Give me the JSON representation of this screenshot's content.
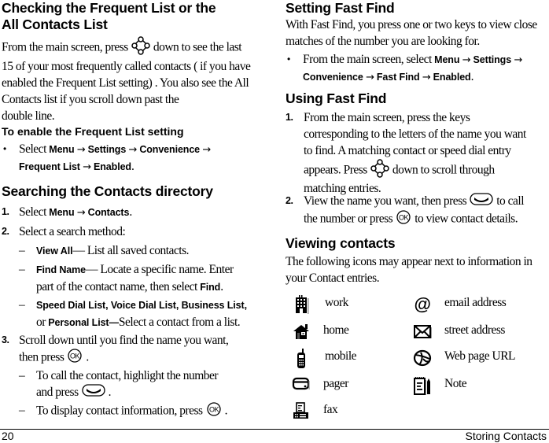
{
  "left": {
    "freq_heading_line1": "Checking the Frequent List or the",
    "freq_heading_line2": "All Contacts List",
    "freq_para": {
      "l1_a": "From the main screen, press",
      "l1_b": "down to see the last",
      "l2": "15 of your most frequently called contacts ( if you have",
      "l3": "enabled the Frequent List setting) . You also see the All",
      "l4": "Contacts list if you scroll down past the",
      "l5": "double line."
    },
    "enable_heading": "To enable the Frequent List setting",
    "enable_bullet": {
      "marker": "•",
      "select": "Select",
      "menu": "Menu",
      "settings": "Settings",
      "convenience": "Convenience",
      "frequent_list": "Frequent List",
      "enabled": "Enabled",
      "arrow": "→",
      "period": "."
    },
    "search_heading": "Searching the Contacts directory",
    "steps": [
      {
        "num": "1.",
        "select": "Select",
        "menu": "Menu",
        "contacts": "Contacts",
        "arrow": "→",
        "period": "."
      },
      {
        "num": "2.",
        "text": "Select a search method:"
      },
      {
        "num": "3.",
        "l1": "Scroll down until you find the name you want,",
        "l2": "then press",
        "period": "."
      }
    ],
    "search_methods": [
      {
        "dash": "–",
        "name": "View All",
        "sep": "—",
        "desc": " List all saved contacts."
      },
      {
        "dash": "–",
        "name": "Find Name",
        "sep": "—",
        "desc": " Locate a specific name. Enter",
        "l2": "part of the contact name, then select ",
        "find": "Find",
        "period": "."
      },
      {
        "dash": "–",
        "name": "Speed Dial List, Voice Dial List, Business List,",
        "l2_or": "or ",
        "personal": "Personal List",
        "sep": "—",
        "desc": "Select a contact from a list."
      }
    ],
    "step3_subs": [
      {
        "dash": "–",
        "l1": "To call the contact, highlight the number",
        "l2": "and press",
        "period": "."
      },
      {
        "dash": "–",
        "l1": "To display contact information, press",
        "period": "."
      }
    ]
  },
  "right": {
    "fastfind_heading": "Setting Fast Find",
    "fastfind_para_l1": "With Fast Find, you press one or two keys to view close",
    "fastfind_para_l2": "matches of the number you are looking for.",
    "fastfind_bullet": {
      "marker": "•",
      "from": "From the main screen, select ",
      "menu": "Menu",
      "settings": "Settings",
      "convenience": "Convenience",
      "fast_find": "Fast Find",
      "enabled": "Enabled",
      "arrow": "→",
      "period": "."
    },
    "using_heading": "Using Fast Find",
    "using_steps": [
      {
        "num": "1.",
        "l1": "From the main screen, press the keys",
        "l2": "corresponding to the letters of the name you want",
        "l3": "to find. A matching contact or speed dial entry",
        "l4a": "appears. Press",
        "l4b": "down to scroll through",
        "l5": "matching entries."
      },
      {
        "num": "2.",
        "l1a": "View the name you want, then press",
        "l1b": "to call",
        "l2a": "the number or press",
        "l2b": "to view contact details."
      }
    ],
    "viewing_heading": "Viewing contacts",
    "viewing_para_l1": "The following icons may appear next to information in",
    "viewing_para_l2": "your Contact entries.",
    "icons": [
      {
        "icon": "work-building-icon",
        "label": "work"
      },
      {
        "icon": "email-at-icon",
        "label": "email address"
      },
      {
        "icon": "home-house-icon",
        "label": "home"
      },
      {
        "icon": "street-envelope-icon",
        "label": "street address"
      },
      {
        "icon": "mobile-phone-icon",
        "label": "mobile"
      },
      {
        "icon": "web-globe-icon",
        "label": "Web page URL"
      },
      {
        "icon": "pager-icon",
        "label": "pager"
      },
      {
        "icon": "note-pad-icon",
        "label": "Note"
      },
      {
        "icon": "fax-machine-icon",
        "label": "fax"
      }
    ]
  },
  "footer": {
    "page_number": "20",
    "chapter_title": "Storing Contacts"
  }
}
